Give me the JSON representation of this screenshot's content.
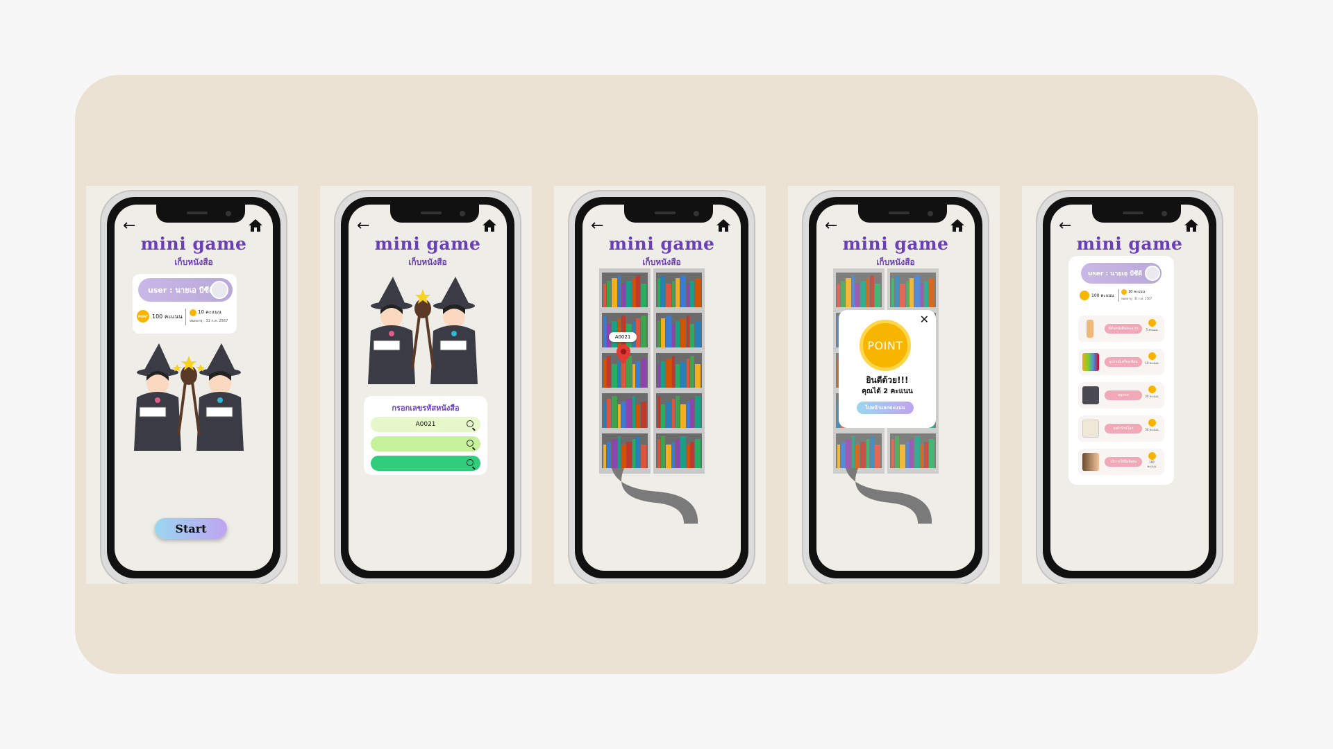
{
  "header": {
    "title": "mini game",
    "subtitle": "เก็บหนังสือ",
    "back_icon": "arrow-left-icon",
    "home_icon": "home-icon"
  },
  "user": {
    "label": "user : นายเอ บีซีดี",
    "points": "100 คะแนน",
    "coin_label": "POINT",
    "small_points": "10 คะแนน",
    "expiry": "หมดอายุ : 31 ก.ค. 2567"
  },
  "screen1": {
    "start_label": "Start"
  },
  "screen2": {
    "code_title": "กรอกเลขรหัสหนังสือ",
    "input_value": "A0021",
    "input_colors": [
      "#e6f7c9",
      "#c5f29a",
      "#2fcd7c"
    ]
  },
  "screen3": {
    "marker_label": "A0021",
    "marker_color": "#e53935"
  },
  "screen4": {
    "point_label": "POINT",
    "congrats": "ยินดีด้วย!!!",
    "earned": "คุณได้ 2 คะแนน",
    "button": "ไปหน้าแลกคะแนน"
  },
  "screen5": {
    "rewards": [
      {
        "label": "ที่คั่นหนังสือ/คะแนน",
        "cost": "5 คะแนน"
      },
      {
        "label": "อุปกรณ์เครื่องเขียน",
        "cost": "10 คะแนน"
      },
      {
        "label": "สมุดจด",
        "cost": "20 คะแนน"
      },
      {
        "label": "ถุงผ้ารักษ์โลก",
        "cost": "50 คะแนน"
      },
      {
        "label": "บริการให้ยืมพิเศษ",
        "cost": "100 คะแนน"
      }
    ]
  },
  "colors": {
    "board": "#ebe2d4",
    "title": "#6b3fb8",
    "coin": "#f7b500"
  }
}
